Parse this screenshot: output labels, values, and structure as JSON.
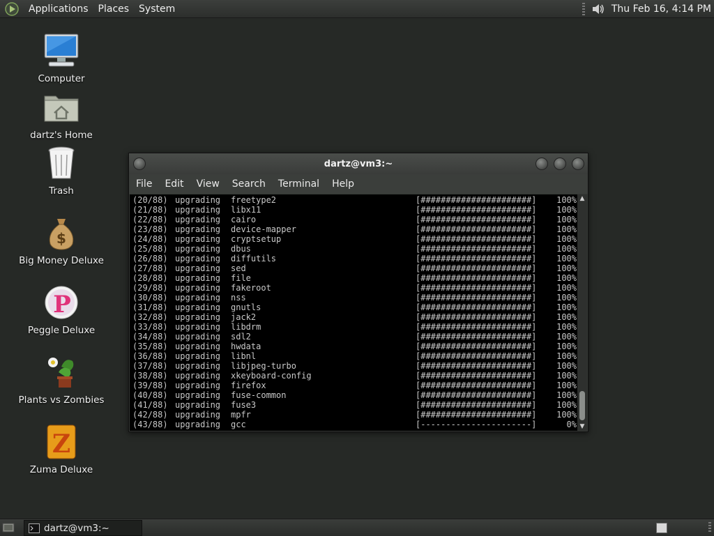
{
  "top_panel": {
    "menus": [
      "Applications",
      "Places",
      "System"
    ],
    "clock": "Thu Feb 16,  4:14 PM"
  },
  "desktop_icons": [
    {
      "label": "Computer",
      "icon": "computer-icon"
    },
    {
      "label": "dartz's Home",
      "icon": "home-folder-icon"
    },
    {
      "label": "Trash",
      "icon": "trash-icon"
    },
    {
      "label": "Big Money Deluxe",
      "icon": "money-bag-icon"
    },
    {
      "label": "Peggle Deluxe",
      "icon": "peggle-icon"
    },
    {
      "label": "Plants vs Zombies",
      "icon": "plants-vs-zombies-icon"
    },
    {
      "label": "Zuma Deluxe",
      "icon": "zuma-icon"
    }
  ],
  "terminal": {
    "title": "dartz@vm3:~",
    "menu": [
      "File",
      "Edit",
      "View",
      "Search",
      "Terminal",
      "Help"
    ],
    "lines": [
      {
        "num": "(20/88)",
        "action": "upgrading",
        "pkg": "freetype2",
        "bar": "[######################]",
        "pct": "100%"
      },
      {
        "num": "(21/88)",
        "action": "upgrading",
        "pkg": "libx11",
        "bar": "[######################]",
        "pct": "100%"
      },
      {
        "num": "(22/88)",
        "action": "upgrading",
        "pkg": "cairo",
        "bar": "[######################]",
        "pct": "100%"
      },
      {
        "num": "(23/88)",
        "action": "upgrading",
        "pkg": "device-mapper",
        "bar": "[######################]",
        "pct": "100%"
      },
      {
        "num": "(24/88)",
        "action": "upgrading",
        "pkg": "cryptsetup",
        "bar": "[######################]",
        "pct": "100%"
      },
      {
        "num": "(25/88)",
        "action": "upgrading",
        "pkg": "dbus",
        "bar": "[######################]",
        "pct": "100%"
      },
      {
        "num": "(26/88)",
        "action": "upgrading",
        "pkg": "diffutils",
        "bar": "[######################]",
        "pct": "100%"
      },
      {
        "num": "(27/88)",
        "action": "upgrading",
        "pkg": "sed",
        "bar": "[######################]",
        "pct": "100%"
      },
      {
        "num": "(28/88)",
        "action": "upgrading",
        "pkg": "file",
        "bar": "[######################]",
        "pct": "100%"
      },
      {
        "num": "(29/88)",
        "action": "upgrading",
        "pkg": "fakeroot",
        "bar": "[######################]",
        "pct": "100%"
      },
      {
        "num": "(30/88)",
        "action": "upgrading",
        "pkg": "nss",
        "bar": "[######################]",
        "pct": "100%"
      },
      {
        "num": "(31/88)",
        "action": "upgrading",
        "pkg": "gnutls",
        "bar": "[######################]",
        "pct": "100%"
      },
      {
        "num": "(32/88)",
        "action": "upgrading",
        "pkg": "jack2",
        "bar": "[######################]",
        "pct": "100%"
      },
      {
        "num": "(33/88)",
        "action": "upgrading",
        "pkg": "libdrm",
        "bar": "[######################]",
        "pct": "100%"
      },
      {
        "num": "(34/88)",
        "action": "upgrading",
        "pkg": "sdl2",
        "bar": "[######################]",
        "pct": "100%"
      },
      {
        "num": "(35/88)",
        "action": "upgrading",
        "pkg": "hwdata",
        "bar": "[######################]",
        "pct": "100%"
      },
      {
        "num": "(36/88)",
        "action": "upgrading",
        "pkg": "libnl",
        "bar": "[######################]",
        "pct": "100%"
      },
      {
        "num": "(37/88)",
        "action": "upgrading",
        "pkg": "libjpeg-turbo",
        "bar": "[######################]",
        "pct": "100%"
      },
      {
        "num": "(38/88)",
        "action": "upgrading",
        "pkg": "xkeyboard-config",
        "bar": "[######################]",
        "pct": "100%"
      },
      {
        "num": "(39/88)",
        "action": "upgrading",
        "pkg": "firefox",
        "bar": "[######################]",
        "pct": "100%"
      },
      {
        "num": "(40/88)",
        "action": "upgrading",
        "pkg": "fuse-common",
        "bar": "[######################]",
        "pct": "100%"
      },
      {
        "num": "(41/88)",
        "action": "upgrading",
        "pkg": "fuse3",
        "bar": "[######################]",
        "pct": "100%"
      },
      {
        "num": "(42/88)",
        "action": "upgrading",
        "pkg": "mpfr",
        "bar": "[######################]",
        "pct": "100%"
      },
      {
        "num": "(43/88)",
        "action": "upgrading",
        "pkg": "gcc",
        "bar": "[----------------------]",
        "pct": "0%"
      }
    ]
  },
  "taskbar": {
    "task_label": "dartz@vm3:~"
  }
}
